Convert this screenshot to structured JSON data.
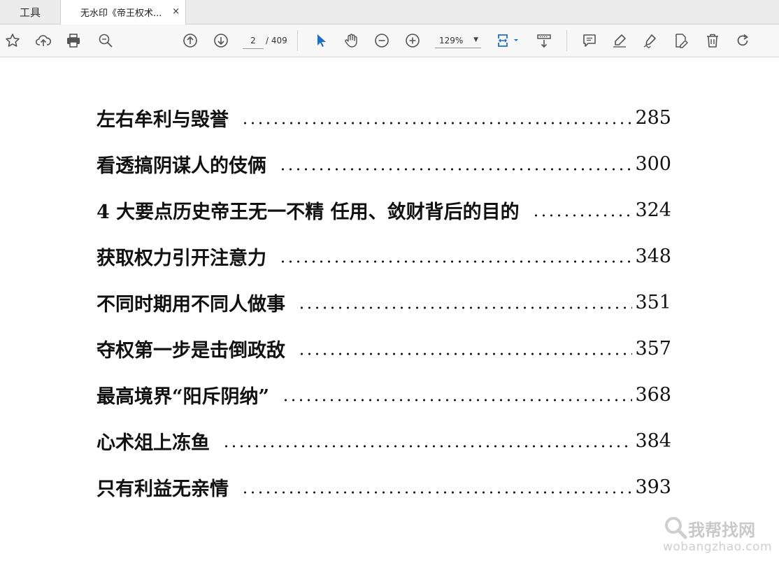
{
  "tabs": {
    "tools_label": "工具",
    "document_label": "无水印《帝王权术...",
    "close_symbol": "×"
  },
  "toolbar": {
    "current_page": "2",
    "total_pages": "/ 409",
    "zoom": "129%",
    "icons": [
      "star-icon",
      "cloud-upload-icon",
      "print-icon",
      "zoom-search-icon",
      "page-up-icon",
      "page-down-icon",
      "select-cursor-icon",
      "hand-icon",
      "zoom-out-icon",
      "zoom-in-icon",
      "fit-page-icon",
      "scroll-mode-icon",
      "comment-icon",
      "highlight-icon",
      "sign-icon",
      "edit-icon",
      "delete-icon",
      "rotate-icon"
    ],
    "accent_color": "#1f6fc5"
  },
  "toc": [
    {
      "title": "左右牟利与毁誉",
      "page": "285"
    },
    {
      "title": "看透搞阴谋人的伎俩",
      "page": "300"
    },
    {
      "title": "4 大要点历史帝王无一不精 任用、敛财背后的目的",
      "page": "324"
    },
    {
      "title": "获取权力引开注意力",
      "page": "348"
    },
    {
      "title": "不同时期用不同人做事",
      "page": "351"
    },
    {
      "title": "夺权第一步是击倒政敌",
      "page": "357"
    },
    {
      "title": "最高境界“阳斥阴纳”",
      "page": "368"
    },
    {
      "title": "心术俎上冻鱼",
      "page": "384"
    },
    {
      "title": "只有利益无亲情",
      "page": "393"
    }
  ],
  "watermark": {
    "cn": "我帮找网",
    "en": "wobangzhao.com"
  }
}
